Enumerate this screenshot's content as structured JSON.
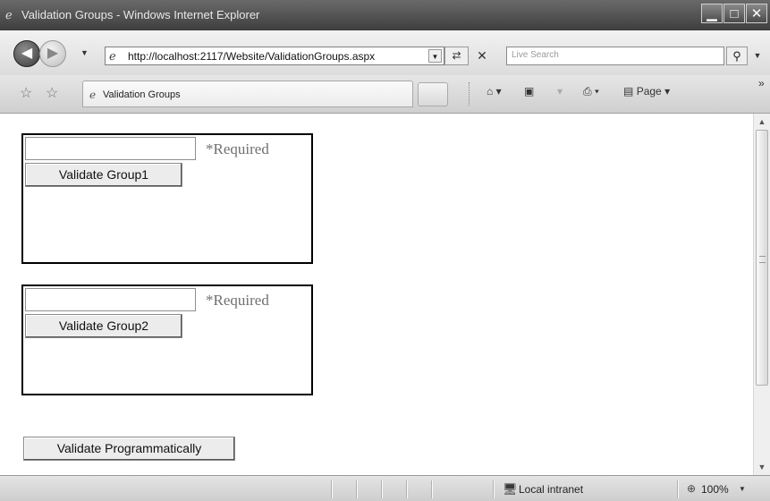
{
  "window": {
    "title": "Validation Groups - Windows Internet Explorer",
    "minimize_glyph": "▁",
    "maximize_glyph": "□",
    "close_glyph": "✕",
    "icon": "ie-logo-icon"
  },
  "address_bar": {
    "url": "http://localhost:2117/Website/ValidationGroups.aspx",
    "search_placeholder": "Live Search"
  },
  "tab": {
    "label": "Validation Groups"
  },
  "command_bar": {
    "page_label": "Page",
    "overflow_glyph": "»"
  },
  "page": {
    "group1": {
      "textbox_value": "",
      "required_text": "*Required",
      "button_label": "Validate Group1"
    },
    "group2": {
      "textbox_value": "",
      "required_text": "*Required",
      "button_label": "Validate Group2"
    },
    "programmatic_button_label": "Validate Programmatically"
  },
  "status_bar": {
    "zone": "Local intranet",
    "zoom": "100%"
  },
  "colors": {
    "title_bar": "#4a4a4a",
    "panel_border": "#000000",
    "required_text": "#707070"
  }
}
